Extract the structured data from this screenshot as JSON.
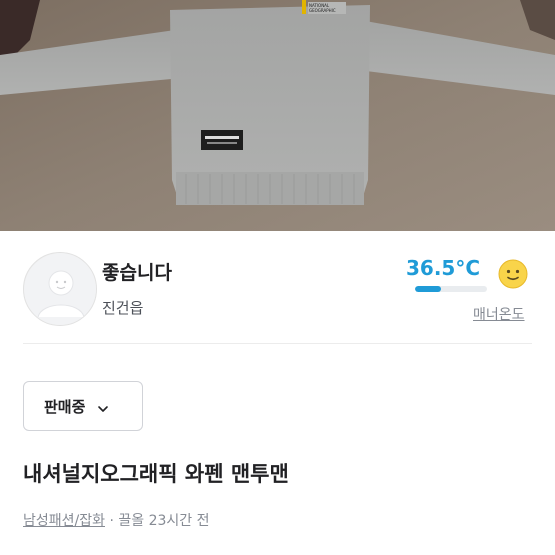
{
  "product_photo": {
    "alt": "grey sweatshirt photo",
    "chest_logo": "NATIONAL GEOGRAPHIC",
    "colors": {
      "sweatshirt": "#a9aaa9",
      "floor": "#8a7c6f",
      "label": "#222222"
    }
  },
  "seller": {
    "name": "좋습니다",
    "location": "진건읍"
  },
  "manner": {
    "temperature": "36.5°C",
    "level_fraction": 0.365,
    "label": "매너온도",
    "emoji_icon": "smiley-icon",
    "color": "#1f9bd7"
  },
  "status": {
    "label": "판매중",
    "icon": "chevron-down-icon"
  },
  "post": {
    "title": "내셔널지오그래픽 와펜 맨투맨",
    "category": "남성패션/잡화",
    "separator": " · ",
    "time": "끌올 23시간 전"
  }
}
